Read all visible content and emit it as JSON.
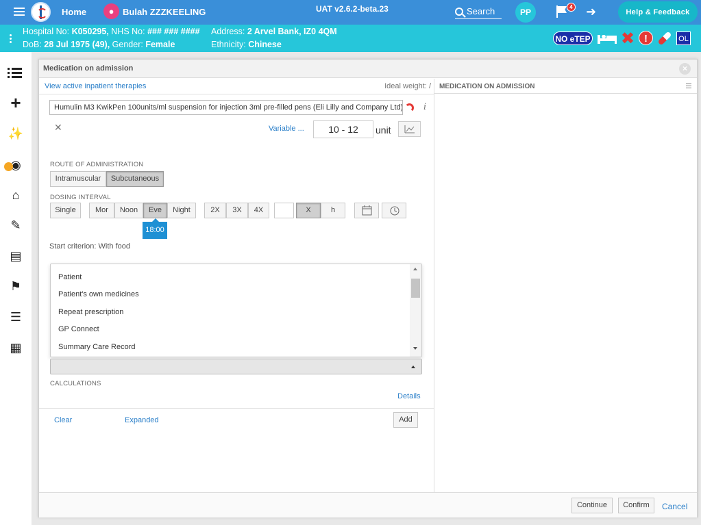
{
  "topbar": {
    "home_label": "Home",
    "patient_name": "Bulah ZZZKEELING",
    "version": "UAT v2.6.2-beta.23",
    "search_label": "Search",
    "user_initials": "PP",
    "flag_count": "4",
    "help_label": "Help & Feedback",
    "color": "#3a8fd9"
  },
  "banner": {
    "hospital_label": "Hospital No:",
    "hospital_no": "K050295,",
    "nhs_label": "NHS No:",
    "nhs_no": "### ### ####",
    "address_label": "Address:",
    "address": "2 Arvel Bank, IZ0 4QM",
    "dob_label": "DoB:",
    "dob": "28 Jul 1975 (49),",
    "gender_label": "Gender:",
    "gender": "Female",
    "ethnicity_label": "Ethnicity:",
    "ethnicity": "Chinese",
    "noetep_label": "NO eTEP",
    "ol_label": "OL",
    "color": "#26c6da"
  },
  "sidebar": {
    "icons": [
      "list-icon",
      "plus-icon",
      "stethoscope-icon",
      "camera-icon",
      "home-icon",
      "edit-icon",
      "inbox-icon",
      "discharge-icon",
      "checklist-icon",
      "building-icon"
    ]
  },
  "modal": {
    "title": "Medication on admission",
    "view_inpatient_link": "View active inpatient therapies",
    "ideal_weight": "Ideal weight: /",
    "right_title": "MEDICATION ON ADMISSION",
    "drug_name": "Humulin M3 KwikPen 100units/ml suspension for injection 3ml pre-filled pens (Eli Lilly and Company Ltd)",
    "variable_link": "Variable ...",
    "dose_value": "10 - 12",
    "dose_unit": "unit",
    "route_label": "ROUTE OF ADMINISTRATION",
    "routes": [
      "Intramuscular",
      "Subcutaneous"
    ],
    "dosing_label": "DOSING INTERVAL",
    "single_label": "Single",
    "times": [
      "Mor",
      "Noon",
      "Eve",
      "Night"
    ],
    "frequencies": [
      "2X",
      "3X",
      "4X"
    ],
    "x_label": "X",
    "h_label": "h",
    "tooltip_time": "18:00",
    "start_criterion": "Start criterion: With food",
    "source_options": [
      "Patient",
      "Patient's own medicines",
      "Repeat prescription",
      "GP Connect",
      "Summary Care Record"
    ],
    "calculations_label": "CALCULATIONS",
    "details_link": "Details",
    "clear_link": "Clear",
    "expanded_link": "Expanded",
    "add_label": "Add",
    "continue_label": "Continue",
    "confirm_label": "Confirm",
    "cancel_label": "Cancel"
  }
}
